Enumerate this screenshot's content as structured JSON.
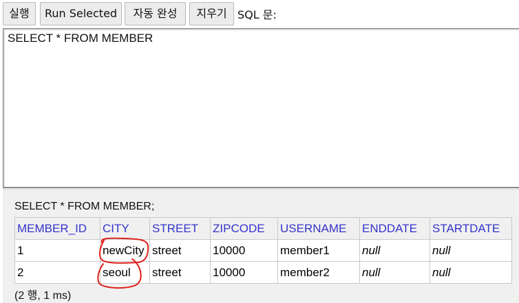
{
  "toolbar": {
    "run_label": "실행",
    "run_selected_label": "Run Selected",
    "autocomplete_label": "자동 완성",
    "clear_label": "지우기",
    "sql_label": "SQL 문:"
  },
  "editor": {
    "text": "SELECT * FROM MEMBER"
  },
  "results": {
    "query": "SELECT * FROM MEMBER;",
    "columns": [
      "MEMBER_ID",
      "CITY",
      "STREET",
      "ZIPCODE",
      "USERNAME",
      "ENDDATE",
      "STARTDATE"
    ],
    "rows": [
      [
        "1",
        "newCity",
        "street",
        "10000",
        "member1",
        "null",
        "null"
      ],
      [
        "2",
        "seoul",
        "street",
        "10000",
        "member2",
        "null",
        "null"
      ]
    ],
    "summary": "(2 행, 1 ms)"
  },
  "colors": {
    "header_text": "#3333cc",
    "annotation": "#e0201a"
  }
}
